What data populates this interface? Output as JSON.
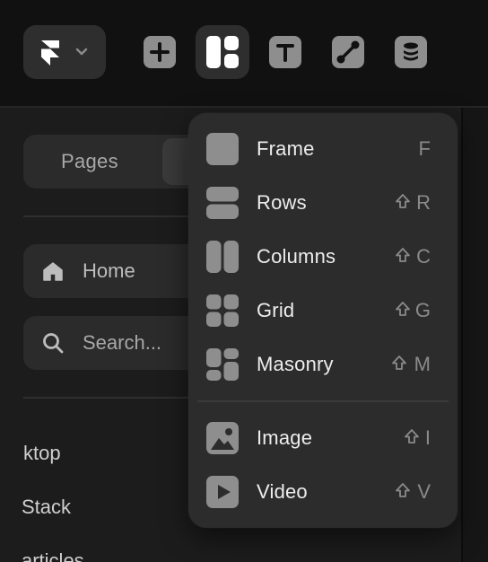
{
  "toolbar": {
    "logo_icon": "framer-logo-icon",
    "tools": [
      {
        "name": "insert",
        "icon": "plus-icon",
        "active": false
      },
      {
        "name": "layout",
        "icon": "layout-icon",
        "active": true
      },
      {
        "name": "text",
        "icon": "text-icon",
        "active": false
      },
      {
        "name": "vector",
        "icon": "vector-path-icon",
        "active": false
      },
      {
        "name": "cms",
        "icon": "database-icon",
        "active": false
      }
    ]
  },
  "sidebar": {
    "segment": {
      "pages_label": "Pages"
    },
    "home_label": "Home",
    "search_placeholder": "Search...",
    "layers": [
      "ktop",
      "Stack",
      "articles"
    ]
  },
  "menu": {
    "items": [
      {
        "label": "Frame",
        "shortcut": "F",
        "shift": false,
        "icon": "frame-icon"
      },
      {
        "label": "Rows",
        "shortcut": "R",
        "shift": true,
        "icon": "rows-icon"
      },
      {
        "label": "Columns",
        "shortcut": "C",
        "shift": true,
        "icon": "columns-icon"
      },
      {
        "label": "Grid",
        "shortcut": "G",
        "shift": true,
        "icon": "grid-icon"
      },
      {
        "label": "Masonry",
        "shortcut": "M",
        "shift": true,
        "icon": "masonry-icon"
      },
      {
        "label": "Image",
        "shortcut": "I",
        "shift": true,
        "icon": "image-icon"
      },
      {
        "label": "Video",
        "shortcut": "V",
        "shift": true,
        "icon": "video-icon"
      }
    ]
  },
  "colors": {
    "background": "#111111",
    "sidebar": "#1c1c1c",
    "menu": "#2c2c2c",
    "icon_gray": "#8e8e8e",
    "icon_white": "#ffffff",
    "text": "#ededed"
  }
}
